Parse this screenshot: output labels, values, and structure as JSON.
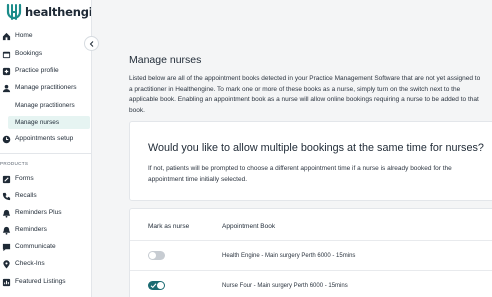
{
  "brand": {
    "name": "healthengine",
    "color": "#1b8c8a"
  },
  "sidebar": {
    "items": [
      {
        "label": "Home",
        "icon": "home-icon"
      },
      {
        "label": "Bookings",
        "icon": "calendar-icon"
      },
      {
        "label": "Practice profile",
        "icon": "plus-square-icon"
      },
      {
        "label": "Manage practitioners",
        "icon": "person-icon"
      },
      {
        "label": "Appointments setup",
        "icon": "clock-icon"
      }
    ],
    "sub_items": [
      {
        "label": "Manage practitioners"
      },
      {
        "label": "Manage nurses",
        "active": true
      }
    ],
    "products_label": "PRODUCTS",
    "products": [
      {
        "label": "Forms",
        "icon": "edit-icon"
      },
      {
        "label": "Recalls",
        "icon": "phone-icon"
      },
      {
        "label": "Reminders Plus",
        "icon": "bell-icon"
      },
      {
        "label": "Reminders",
        "icon": "bell-icon"
      },
      {
        "label": "Communicate",
        "icon": "chat-icon"
      },
      {
        "label": "Check-Ins",
        "icon": "map-pin-icon"
      },
      {
        "label": "Featured Listings",
        "icon": "chart-icon"
      }
    ]
  },
  "main": {
    "title": "Manage nurses",
    "intro": "Listed below are all of the appointment books detected in your Practice Management Software that are not yet assigned to a practitioner in Healthengine. To mark one or more of these books as a nurse, simply turn on the switch next to the applicable book. Enabling an appointment book as a nurse will allow online bookings requiring a nurse to be added to that book.",
    "multi_booking": {
      "question": "Would you like to allow multiple bookings at the same time for nurses?",
      "description": "If not, patients will be prompted to choose a different appointment time if a nurse is already booked for the appointment time initially selected."
    },
    "table": {
      "headers": [
        "Mark as nurse",
        "Appointment Book"
      ],
      "rows": [
        {
          "book": "Health Engine - Main surgery Perth 6000 - 15mins",
          "enabled": false
        },
        {
          "book": "Nurse Four - Main surgery Perth 6000 - 15mins",
          "enabled": true
        }
      ]
    }
  }
}
